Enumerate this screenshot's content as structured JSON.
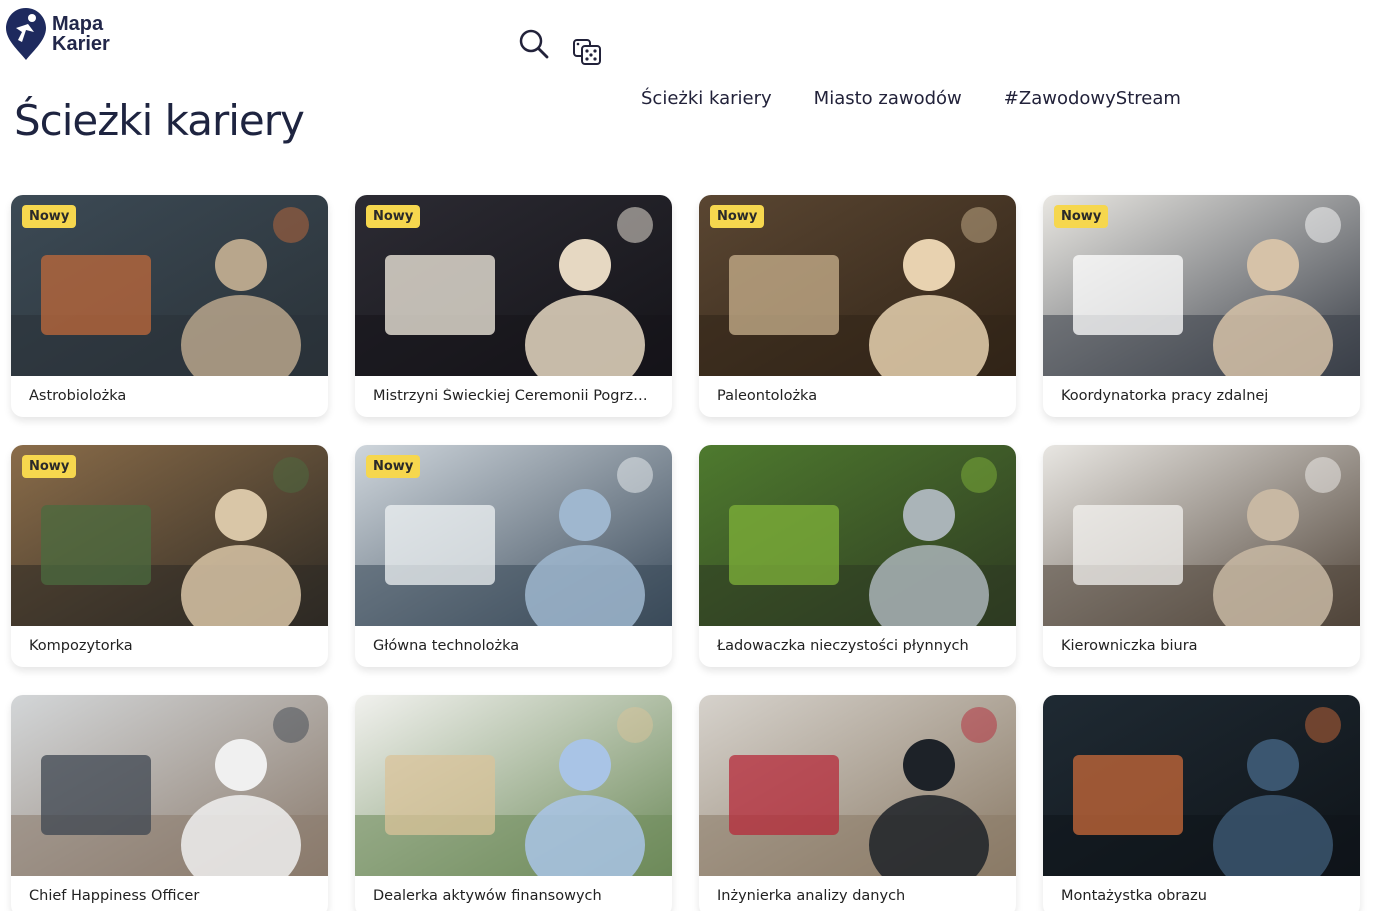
{
  "brand": {
    "line1": "Mapa",
    "line2": "Karier"
  },
  "header": {
    "search_icon": "search-icon",
    "random_icon": "dice-icon"
  },
  "nav": {
    "items": [
      {
        "label": "Ścieżki kariery"
      },
      {
        "label": "Miasto zawodów"
      },
      {
        "label": "#ZawodowyStream"
      }
    ]
  },
  "page": {
    "title": "Ścieżki kariery"
  },
  "colors": {
    "accent": "#f6d74e",
    "brand": "#22274a"
  },
  "cards": [
    {
      "title": "Astrobiolożka",
      "badge": "Nowy",
      "scene": [
        "#3c4a55",
        "#b8a68c",
        "#c06a3b",
        "#2a3238"
      ]
    },
    {
      "title": "Mistrzyni Świeckiej Ceremonii Pogrzeb...",
      "badge": "Nowy",
      "scene": [
        "#2c2b33",
        "#e6d8c2",
        "#f7f0e3",
        "#151419"
      ]
    },
    {
      "title": "Paleontolożka",
      "badge": "Nowy",
      "scene": [
        "#5a4632",
        "#e8d2b0",
        "#c9b18d",
        "#312417"
      ]
    },
    {
      "title": "Koordynatorka pracy zdalnej",
      "badge": "Nowy",
      "scene": [
        "#e9e7e2",
        "#d6c2a8",
        "#ffffff",
        "#3a3f48"
      ]
    },
    {
      "title": "Kompozytorka",
      "badge": "Nowy",
      "scene": [
        "#8a6c49",
        "#d9c6a7",
        "#4b6b3f",
        "#2e2a24"
      ]
    },
    {
      "title": "Główna technolożka",
      "badge": "Nowy",
      "scene": [
        "#cfd6dc",
        "#9fb7cf",
        "#eef1f3",
        "#3a4a5a"
      ]
    },
    {
      "title": "Ładowaczka nieczystości płynnych",
      "badge": "",
      "scene": [
        "#4e7a2e",
        "#aab4b8",
        "#7fb23a",
        "#2e3a22"
      ]
    },
    {
      "title": "Kierowniczka biura",
      "badge": "",
      "scene": [
        "#e8e6e2",
        "#c8b8a3",
        "#f3f2ef",
        "#51453a"
      ]
    },
    {
      "title": "Chief Happiness Officer",
      "badge": "",
      "scene": [
        "#d3d6d8",
        "#f0f0f0",
        "#3d4650",
        "#8a7a6c"
      ]
    },
    {
      "title": "Dealerka aktywów finansowych",
      "badge": "",
      "scene": [
        "#f1f1ee",
        "#a9c4e6",
        "#d9c39a",
        "#6d8a5a"
      ]
    },
    {
      "title": "Inżynierka analizy danych",
      "badge": "",
      "scene": [
        "#d6d2cc",
        "#1d2228",
        "#b62a3a",
        "#8a7a66"
      ]
    },
    {
      "title": "Montażystka obrazu",
      "badge": "",
      "scene": [
        "#1f2a33",
        "#3b5670",
        "#c96a3a",
        "#0f1419"
      ]
    }
  ]
}
